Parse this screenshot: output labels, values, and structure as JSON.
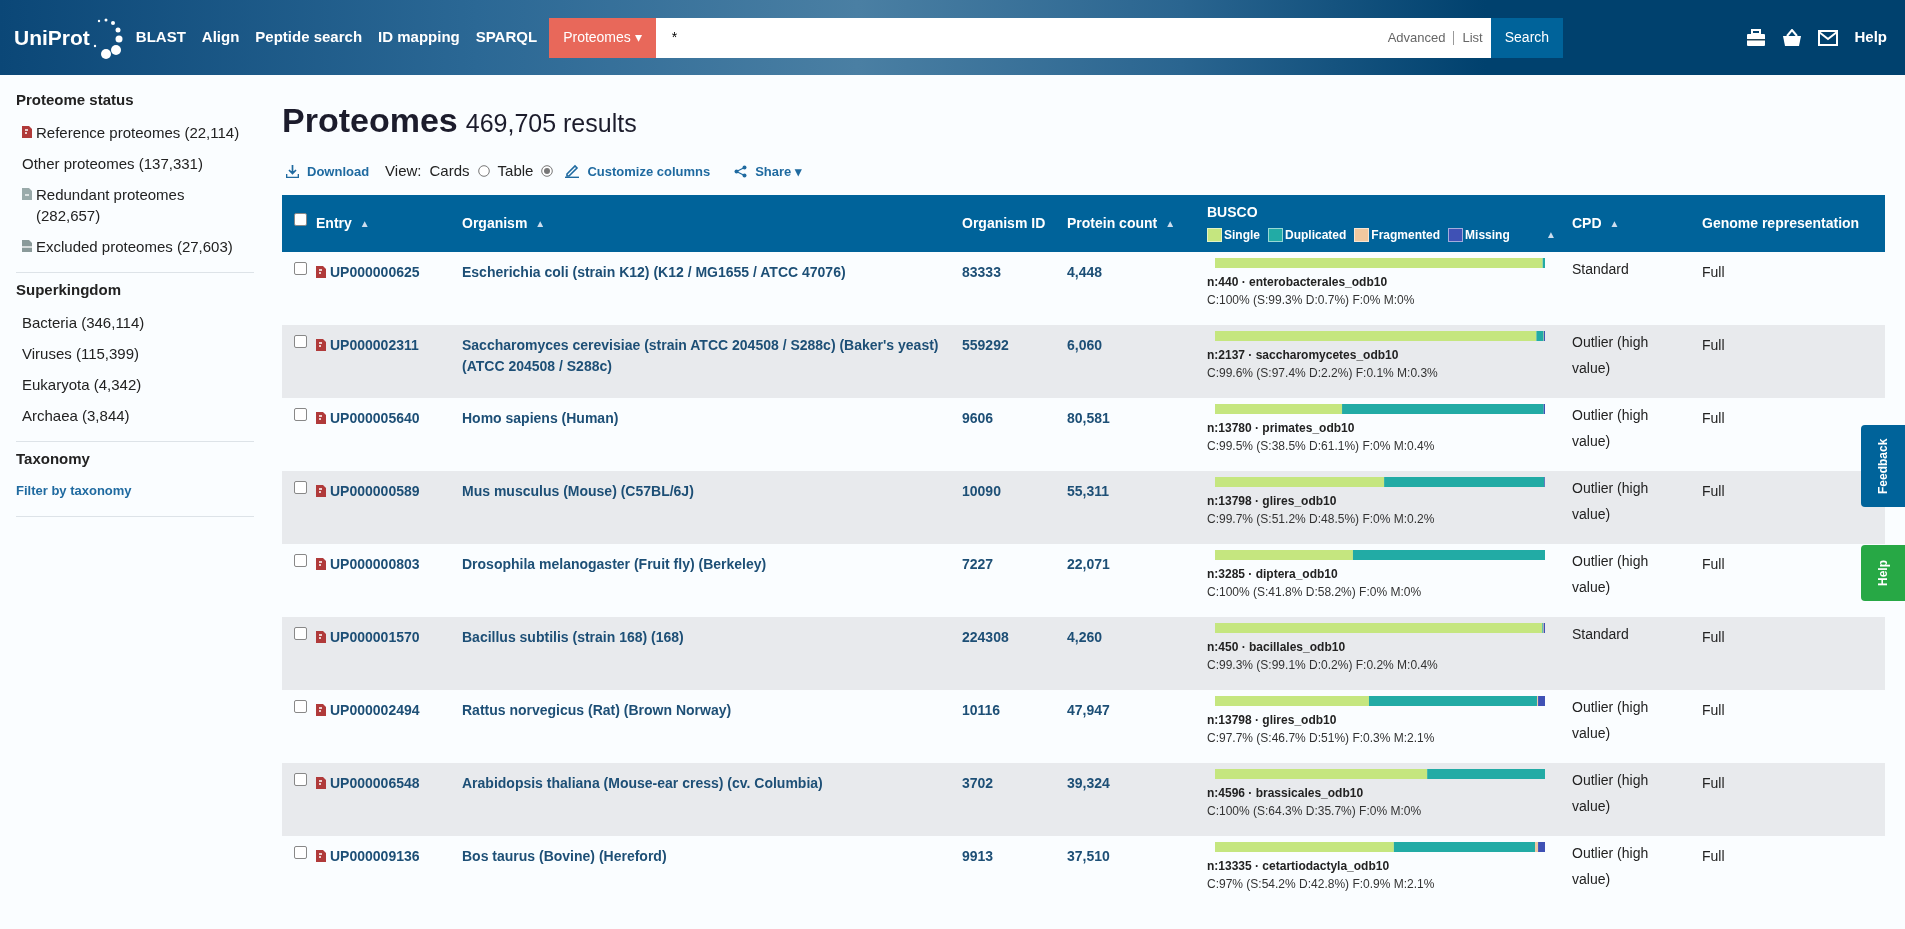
{
  "header": {
    "logo": "UniProt",
    "nav": [
      "BLAST",
      "Align",
      "Peptide search",
      "ID mapping",
      "SPARQL"
    ],
    "search": {
      "scope": "Proteomes",
      "caret": "▾",
      "value": "*",
      "advanced": "Advanced",
      "list": "List",
      "button": "Search"
    },
    "help": "Help"
  },
  "sidebar": [
    {
      "title": "Proteome status",
      "items": [
        {
          "label": "Reference proteomes (22,114)",
          "kind": "reference"
        },
        {
          "label": "Other proteomes (137,331)",
          "kind": "plain"
        },
        {
          "label": "Redundant proteomes (282,657)",
          "kind": "redundant"
        },
        {
          "label": "Excluded proteomes (27,603)",
          "kind": "excluded"
        }
      ]
    },
    {
      "title": "Superkingdom",
      "items": [
        {
          "label": "Bacteria (346,114)",
          "kind": "plain"
        },
        {
          "label": "Viruses (115,399)",
          "kind": "plain"
        },
        {
          "label": "Eukaryota (4,342)",
          "kind": "plain"
        },
        {
          "label": "Archaea (3,844)",
          "kind": "plain"
        }
      ]
    },
    {
      "title": "Taxonomy",
      "items": [
        {
          "label": "Filter by taxonomy",
          "kind": "link"
        }
      ]
    }
  ],
  "page": {
    "title": "Proteomes",
    "count": "469,705 results"
  },
  "toolbar": {
    "download": "Download",
    "view_label": "View:",
    "view_options": [
      {
        "label": "Cards",
        "selected": false
      },
      {
        "label": "Table",
        "selected": true
      }
    ],
    "customize": "Customize columns",
    "share": "Share",
    "share_caret": "▾"
  },
  "table": {
    "select_all": {
      "checked": false
    },
    "columns": [
      {
        "label": "Entry",
        "sort": "▲"
      },
      {
        "label": "Organism",
        "sort": "▲"
      },
      {
        "label": "Organism ID"
      },
      {
        "label": "Protein count",
        "sort": "▲"
      },
      {
        "label": "BUSCO",
        "sort": "▲"
      },
      {
        "label": "CPD",
        "sort": "▲"
      },
      {
        "label": "Genome representation"
      }
    ],
    "busco_legend": [
      {
        "label": "Single",
        "color": "#c5e67f"
      },
      {
        "label": "Duplicated",
        "color": "#22aba5"
      },
      {
        "label": "Fragmented",
        "color": "#f0c89f"
      },
      {
        "label": "Missing",
        "color": "#3f51b5"
      }
    ],
    "rows": [
      {
        "checked": false,
        "entry": "UP000000625",
        "organism": "Escherichia coli (strain K12) (K12 / MG1655 / ATCC 47076)",
        "organism_id": "83333",
        "protein_count": "4,448",
        "busco": {
          "summary": "n:440 · enterobacterales_odb10",
          "detail": "C:100% (S:99.3% D:0.7%) F:0% M:0%"
        },
        "cpd": "Standard",
        "genome": "Full"
      },
      {
        "checked": false,
        "entry": "UP000002311",
        "organism": "Saccharomyces cerevisiae (strain ATCC 204508 / S288c) (Baker's yeast) (ATCC 204508 / S288c)",
        "organism_id": "559292",
        "protein_count": "6,060",
        "busco": {
          "summary": "n:2137 · saccharomycetes_odb10",
          "detail": "C:99.6% (S:97.4% D:2.2%) F:0.1% M:0.3%"
        },
        "cpd": "Outlier (high value)",
        "genome": "Full"
      },
      {
        "checked": false,
        "entry": "UP000005640",
        "organism": "Homo sapiens (Human)",
        "organism_id": "9606",
        "protein_count": "80,581",
        "busco": {
          "summary": "n:13780 · primates_odb10",
          "detail": "C:99.5% (S:38.5% D:61.1%) F:0% M:0.4%"
        },
        "cpd": "Outlier (high value)",
        "genome": "Full"
      },
      {
        "checked": false,
        "entry": "UP000000589",
        "organism": "Mus musculus (Mouse) (C57BL/6J)",
        "organism_id": "10090",
        "protein_count": "55,311",
        "busco": {
          "summary": "n:13798 · glires_odb10",
          "detail": "C:99.7% (S:51.2% D:48.5%) F:0% M:0.2%"
        },
        "cpd": "Outlier (high value)",
        "genome": "Full"
      },
      {
        "checked": false,
        "entry": "UP000000803",
        "organism": "Drosophila melanogaster (Fruit fly) (Berkeley)",
        "organism_id": "7227",
        "protein_count": "22,071",
        "busco": {
          "summary": "n:3285 · diptera_odb10",
          "detail": "C:100% (S:41.8% D:58.2%) F:0% M:0%"
        },
        "cpd": "Outlier (high value)",
        "genome": "Full"
      },
      {
        "checked": false,
        "entry": "UP000001570",
        "organism": "Bacillus subtilis (strain 168) (168)",
        "organism_id": "224308",
        "protein_count": "4,260",
        "busco": {
          "summary": "n:450 · bacillales_odb10",
          "detail": "C:99.3% (S:99.1% D:0.2%) F:0.2% M:0.4%"
        },
        "cpd": "Standard",
        "genome": "Full"
      },
      {
        "checked": false,
        "entry": "UP000002494",
        "organism": "Rattus norvegicus (Rat) (Brown Norway)",
        "organism_id": "10116",
        "protein_count": "47,947",
        "busco": {
          "summary": "n:13798 · glires_odb10",
          "detail": "C:97.7% (S:46.7% D:51%) F:0.3% M:2.1%"
        },
        "cpd": "Outlier (high value)",
        "genome": "Full"
      },
      {
        "checked": false,
        "entry": "UP000006548",
        "organism": "Arabidopsis thaliana (Mouse-ear cress) (cv. Columbia)",
        "organism_id": "3702",
        "protein_count": "39,324",
        "busco": {
          "summary": "n:4596 · brassicales_odb10",
          "detail": "C:100% (S:64.3% D:35.7%) F:0% M:0%"
        },
        "cpd": "Outlier (high value)",
        "genome": "Full"
      },
      {
        "checked": false,
        "entry": "UP000009136",
        "organism": "Bos taurus (Bovine) (Hereford)",
        "organism_id": "9913",
        "protein_count": "37,510",
        "busco": {
          "summary": "n:13335 · cetartiodactyla_odb10",
          "detail": "C:97% (S:54.2% D:42.8%) F:0.9% M:2.1%"
        },
        "cpd": "Outlier (high value)",
        "genome": "Full"
      }
    ]
  },
  "side_tabs": [
    {
      "label": "Feedback",
      "color": "#00639a"
    },
    {
      "label": "Help",
      "color": "#27a845"
    }
  ]
}
